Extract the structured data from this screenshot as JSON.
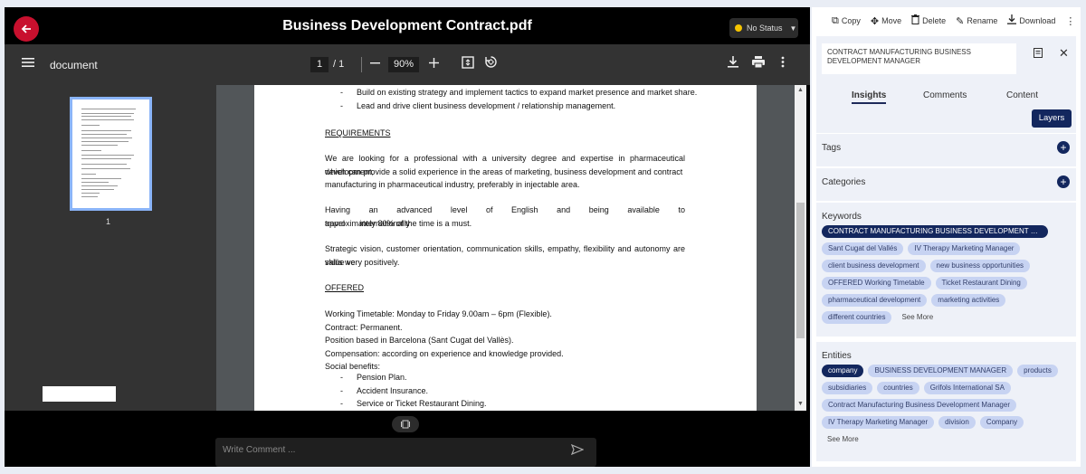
{
  "header": {
    "title": "Business Development Contract.pdf",
    "status_label": "No Status",
    "status_color": "#f5c400",
    "back_icon": "arrow-left-icon"
  },
  "toolbar": {
    "doc_label": "document",
    "page_current": "1",
    "page_total": "/ 1",
    "zoom": "90%"
  },
  "thumbnail": {
    "page_label": "1"
  },
  "document": {
    "bullets_top": [
      "Build on existing strategy and implement tactics to expand market presence and market share.",
      "Lead and drive client business development / relationship management."
    ],
    "requirements_heading": "REQUIREMENTS",
    "req_para1_lines": [
      "We are looking for a professional with a university degree and expertise in pharmaceutical development,",
      "which can provide a solid experience in the areas of marketing, business development and contract",
      "manufacturing in pharmaceutical industry, preferably in injectable area."
    ],
    "req_para2_lines": [
      "Having an advanced level of English and being available to travel internationally",
      "approximately 80% of the time is a must."
    ],
    "req_para3_lines": [
      "Strategic vision, customer orientation, communication skills, empathy, flexibility and autonomy are skills we",
      "value very positively."
    ],
    "offered_heading": "OFFERED",
    "offered_lines": [
      "Working Timetable: Monday to Friday 9.00am – 6pm (Flexible).",
      "Contract: Permanent.",
      "Position based in Barcelona (Sant Cugat del Vallès).",
      "Compensation: according on experience and knowledge provided.",
      "Social benefits:"
    ],
    "benefits": [
      "Pension Plan.",
      "Accident Insurance.",
      "Service or Ticket Restaurant Dining."
    ],
    "bullet_char": "-"
  },
  "comment": {
    "placeholder": "Write Comment ..."
  },
  "panel": {
    "actions": [
      {
        "label": "Copy",
        "icon": "copy-icon"
      },
      {
        "label": "Move",
        "icon": "move-icon"
      },
      {
        "label": "Delete",
        "icon": "trash-icon"
      },
      {
        "label": "Rename",
        "icon": "pencil-icon"
      },
      {
        "label": "Download",
        "icon": "download-icon"
      }
    ],
    "doc_title": "CONTRACT MANUFACTURING BUSINESS DEVELOPMENT MANAGER",
    "tabs": [
      "Insights",
      "Comments",
      "Content"
    ],
    "layers_label": "Layers",
    "tags_label": "Tags",
    "categories_label": "Categories",
    "keywords_label": "Keywords",
    "keywords": [
      "CONTRACT MANUFACTURING BUSINESS DEVELOPMENT MA...",
      "Sant Cugat del Vallés",
      "IV Therapy Marketing Manager",
      "client business development",
      "new business opportunities",
      "OFFERED Working Timetable",
      "Ticket Restaurant Dining",
      "pharmaceutical development",
      "marketing activities",
      "different countries"
    ],
    "keywords_see_more": "See More",
    "entities_label": "Entities",
    "entities": [
      "company",
      "BUSINESS DEVELOPMENT MANAGER",
      "products",
      "subsidiaries",
      "countries",
      "Grifols International SA",
      "Contract Manufacturing Business Development Manager",
      "IV Therapy Marketing Manager",
      "division",
      "Company"
    ],
    "entities_see_more": "See More",
    "accent_color": "#13275e",
    "chip_color": "#c7d3f2"
  }
}
